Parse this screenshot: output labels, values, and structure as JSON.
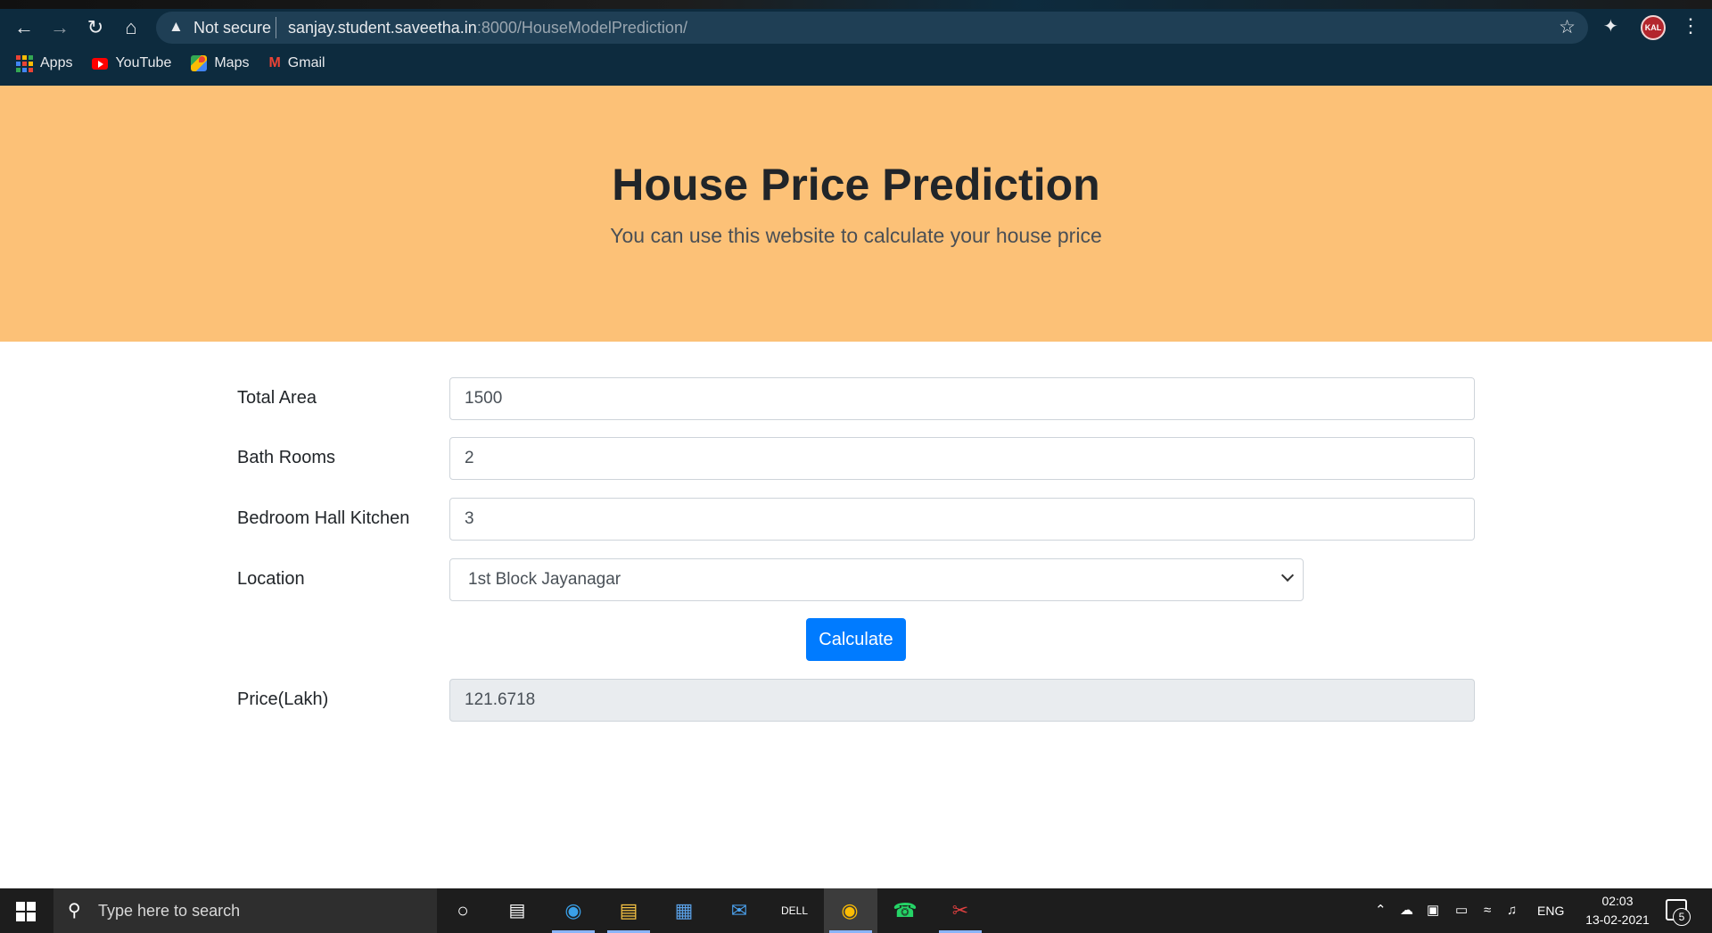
{
  "browser": {
    "not_secure": "Not secure",
    "url_host": "sanjay.student.saveetha.in",
    "url_path": ":8000/HouseModelPrediction/",
    "profile_initials": "KAL",
    "bookmarks": [
      {
        "label": "Apps",
        "icon": "apps-grid-icon"
      },
      {
        "label": "YouTube",
        "icon": "youtube-icon"
      },
      {
        "label": "Maps",
        "icon": "maps-icon"
      },
      {
        "label": "Gmail",
        "icon": "gmail-icon"
      }
    ]
  },
  "hero": {
    "title": "House Price Prediction",
    "subtitle": "You can use this website to calculate your house price",
    "background": "#fcc177"
  },
  "form": {
    "total_area": {
      "label": "Total Area",
      "value": "1500"
    },
    "bath_rooms": {
      "label": "Bath Rooms",
      "value": "2"
    },
    "bhk": {
      "label": "Bedroom Hall Kitchen",
      "value": "3"
    },
    "location": {
      "label": "Location",
      "selected": "1st Block Jayanagar"
    },
    "calculate_label": "Calculate",
    "price": {
      "label": "Price(Lakh)",
      "value": "121.6718"
    }
  },
  "colors": {
    "primary_button": "#007bff"
  },
  "taskbar": {
    "search_placeholder": "Type here to search",
    "language": "ENG",
    "time": "02:03",
    "date": "13-02-2021",
    "notification_count": "5"
  }
}
